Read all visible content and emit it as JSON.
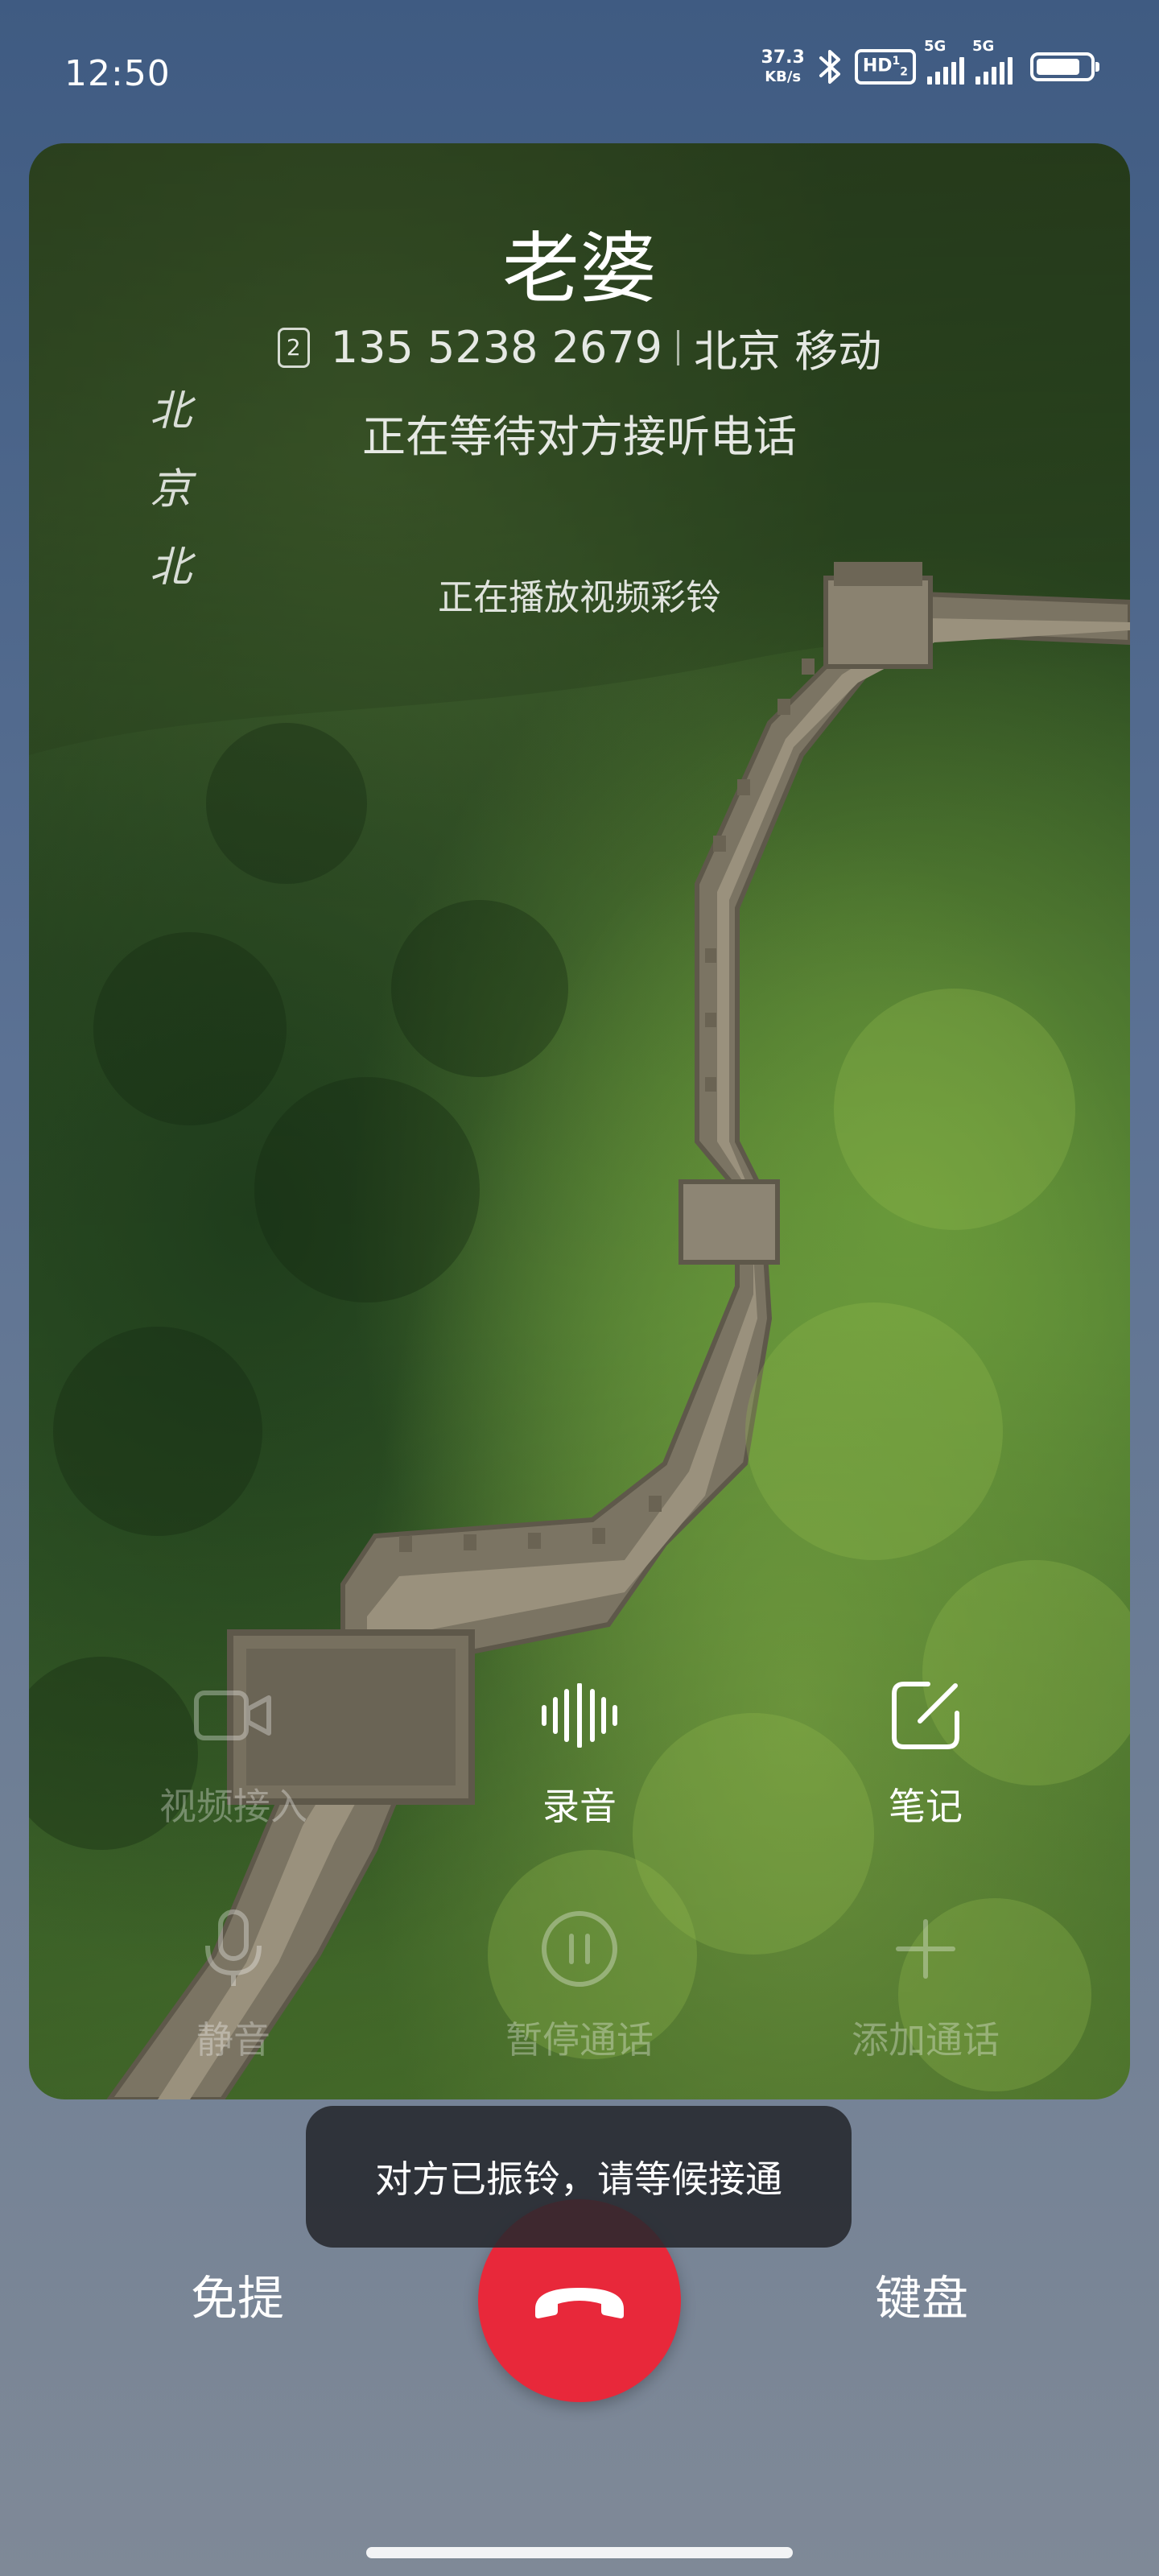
{
  "status_bar": {
    "time": "12:50",
    "net_speed_value": "37.3",
    "net_speed_unit": "KB/s",
    "hd_label": "HD",
    "hd_sub": "1",
    "hd_sub2": "2",
    "sim1_label": "5G",
    "sim2_label": "5G",
    "battery_level": 0.85,
    "icons": [
      "bluetooth-icon",
      "hd-volte-icon",
      "signal-icon",
      "signal-icon",
      "battery-icon"
    ]
  },
  "call": {
    "contact_name": "老婆",
    "sim_slot": "2",
    "phone_number": "135 5238 2679",
    "location_carrier": "北京 移动",
    "status": "正在等待对方接听电话",
    "ringback_status": "正在播放视频彩铃"
  },
  "video": {
    "calligraphy": [
      "北",
      "京",
      "北"
    ]
  },
  "actions": [
    {
      "id": "video-call",
      "label": "视频接入",
      "icon": "video-camera-icon",
      "enabled": false
    },
    {
      "id": "record",
      "label": "录音",
      "icon": "waveform-icon",
      "enabled": true
    },
    {
      "id": "notes",
      "label": "笔记",
      "icon": "note-edit-icon",
      "enabled": true
    },
    {
      "id": "mute",
      "label": "静音",
      "icon": "microphone-icon",
      "enabled": false
    },
    {
      "id": "hold",
      "label": "暂停通话",
      "icon": "pause-icon",
      "enabled": false
    },
    {
      "id": "add-call",
      "label": "添加通话",
      "icon": "plus-icon",
      "enabled": false
    }
  ],
  "toast": {
    "message": "对方已振铃，请等候接通"
  },
  "controls": {
    "speaker_label": "免提",
    "keypad_label": "键盘",
    "end_call_icon": "phone-hangup-icon",
    "end_call_color": "#e8283a"
  }
}
